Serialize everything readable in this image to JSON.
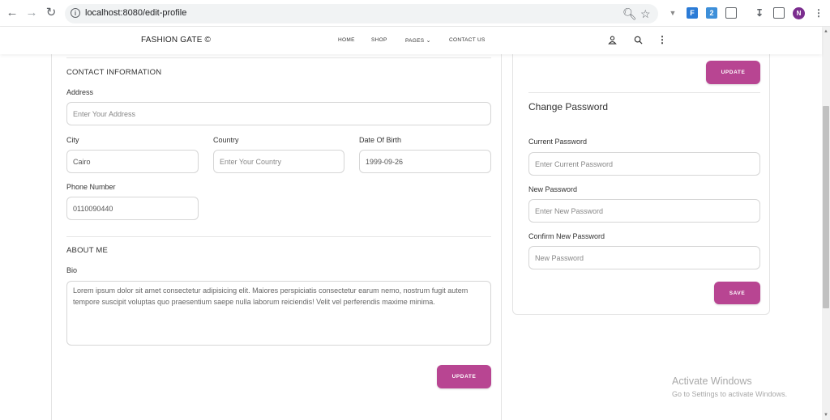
{
  "browser": {
    "url": "localhost:8080/edit-profile",
    "back_icon": "arrow-left-icon",
    "forward_icon": "arrow-right-icon",
    "reload_icon": "reload-icon",
    "profile_initial": "N"
  },
  "site": {
    "brand": "FASHION GATE ©",
    "nav": {
      "home": "HOME",
      "shop": "SHOP",
      "pages": "PAGES",
      "contact": "CONTACT US"
    }
  },
  "contact": {
    "section_title": "CONTACT INFORMATION",
    "address_label": "Address",
    "address_placeholder": "Enter Your Address",
    "city_label": "City",
    "city_value": "Cairo",
    "country_label": "Country",
    "country_placeholder": "Enter Your Country",
    "dob_label": "Date Of Birth",
    "dob_value": "1999-09-26",
    "phone_label": "Phone Number",
    "phone_value": "0110090440"
  },
  "about": {
    "section_title": "ABOUT ME",
    "bio_label": "Bio",
    "bio_value": "Lorem ipsum dolor sit amet consectetur adipisicing elit. Maiores perspiciatis consectetur earum nemo, nostrum fugit autem tempore suscipit voluptas quo praesentium saepe nulla laborum reiciendis! Velit vel perferendis maxime minima.",
    "update_button": "UPDATE"
  },
  "right": {
    "top_update_button": "UPDATE",
    "password_title": "Change Password",
    "current_label": "Current Password",
    "current_placeholder": "Enter Current Password",
    "new_label": "New Password",
    "new_placeholder": "Enter New Password",
    "confirm_label": "Confirm New Password",
    "confirm_placeholder": "New Password",
    "save_button": "SAVE"
  },
  "watermark": {
    "line1": "Activate Windows",
    "line2": "Go to Settings to activate Windows."
  },
  "colors": {
    "accent": "#b84592",
    "border": "#d6d6d6"
  }
}
